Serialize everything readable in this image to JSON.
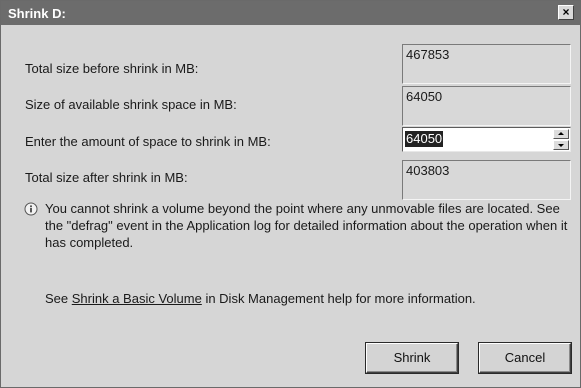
{
  "window": {
    "title": "Shrink D:",
    "close_glyph": "×"
  },
  "rows": [
    {
      "label": "Total size before shrink in MB:",
      "value": "467853"
    },
    {
      "label": "Size of available shrink space in MB:",
      "value": "64050"
    },
    {
      "label": "Enter the amount of space to shrink in MB:",
      "value": "64050"
    },
    {
      "label": "Total size after shrink in MB:",
      "value": "403803"
    }
  ],
  "info": {
    "icon": "info-icon",
    "text": "You cannot shrink a volume beyond the point where any unmovable files are located. See the \"defrag\" event in the Application log for detailed information about the operation when it has completed."
  },
  "help": {
    "prefix": "See ",
    "link_text": "Shrink a Basic Volume",
    "suffix": " in Disk Management help for more information."
  },
  "buttons": {
    "shrink": "Shrink",
    "cancel": "Cancel"
  },
  "colors": {
    "dialog_bg": "#d6d6d6",
    "titlebar_bg": "#6c6c6c",
    "selection_bg": "#222222"
  }
}
